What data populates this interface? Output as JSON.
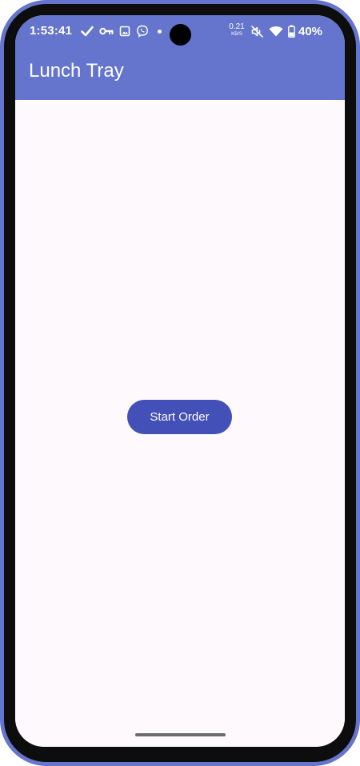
{
  "status_bar": {
    "time": "1:53:41",
    "net_speed_value": "0.21",
    "net_speed_unit": "KB/S",
    "battery_percent": "40%",
    "left_icons": [
      "check-icon",
      "key-icon",
      "image-icon",
      "viber-icon",
      "notification-dot"
    ],
    "right_icons": [
      "mute-icon",
      "wifi-icon",
      "battery-icon"
    ]
  },
  "app_bar": {
    "title": "Lunch Tray"
  },
  "main": {
    "start_button_label": "Start Order"
  },
  "colors": {
    "primary": "#6574cc",
    "button": "#4350b8",
    "background": "#fdf9fc",
    "frame": "#6574cc"
  }
}
